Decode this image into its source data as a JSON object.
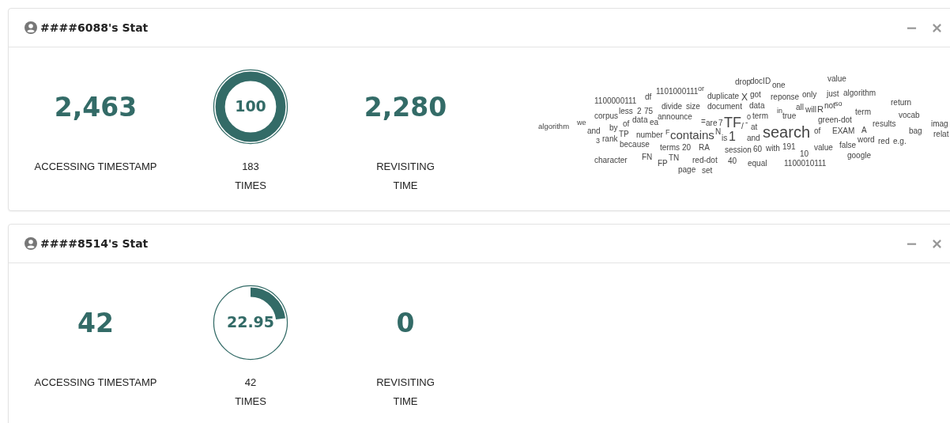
{
  "cards": [
    {
      "title": "####6088's Stat",
      "stats": [
        {
          "kind": "number",
          "value": "2,463",
          "label": "ACCESSING TIMESTAMP"
        },
        {
          "kind": "gauge",
          "value": "100",
          "level": 1,
          "count": "183",
          "label": "TIMES"
        },
        {
          "kind": "number",
          "value": "2,280",
          "label": "REVISITING TIME"
        }
      ],
      "words": [
        "drop",
        "docID",
        "one",
        "value",
        "1101000111",
        "or",
        "df",
        "duplicate",
        "X",
        "got",
        "reponse",
        "only",
        "just",
        "algorithm",
        "1100000111",
        "divide",
        "size",
        "document",
        "data",
        "in",
        "all",
        "will",
        "R",
        "not",
        "so",
        "return",
        "term",
        "corpus",
        "less",
        "2",
        "75",
        "announce",
        "0",
        "term",
        "true",
        "vocab",
        "green-dot",
        "algorithm",
        "we",
        "of",
        "data",
        "ea",
        "=",
        "are",
        "7",
        "TF",
        "/",
        "-",
        "at",
        "search",
        "of",
        "EXAM",
        "A",
        "results",
        "bag",
        "imag",
        "relat",
        "and",
        "by",
        "3",
        "rank",
        "TP",
        "because",
        "number",
        "F",
        "contains",
        "N",
        "is",
        "1",
        "and",
        "word",
        "red",
        "e.g.",
        "terms",
        "20",
        "RA",
        "session",
        "60",
        "with",
        "191",
        "value",
        "false",
        "10",
        "google",
        "character",
        "FN",
        "FP",
        "TN",
        "red-dot",
        "40",
        "equal",
        "1100010111",
        "page",
        "set"
      ]
    },
    {
      "title": "####8514's Stat",
      "stats": [
        {
          "kind": "number",
          "value": "42",
          "label": "ACCESSING TIMESTAMP"
        },
        {
          "kind": "gauge",
          "value": "22.95",
          "level": 0.2295,
          "count": "42",
          "label": "TIMES"
        },
        {
          "kind": "number",
          "value": "0",
          "label": "REVISITING TIME"
        }
      ]
    }
  ]
}
